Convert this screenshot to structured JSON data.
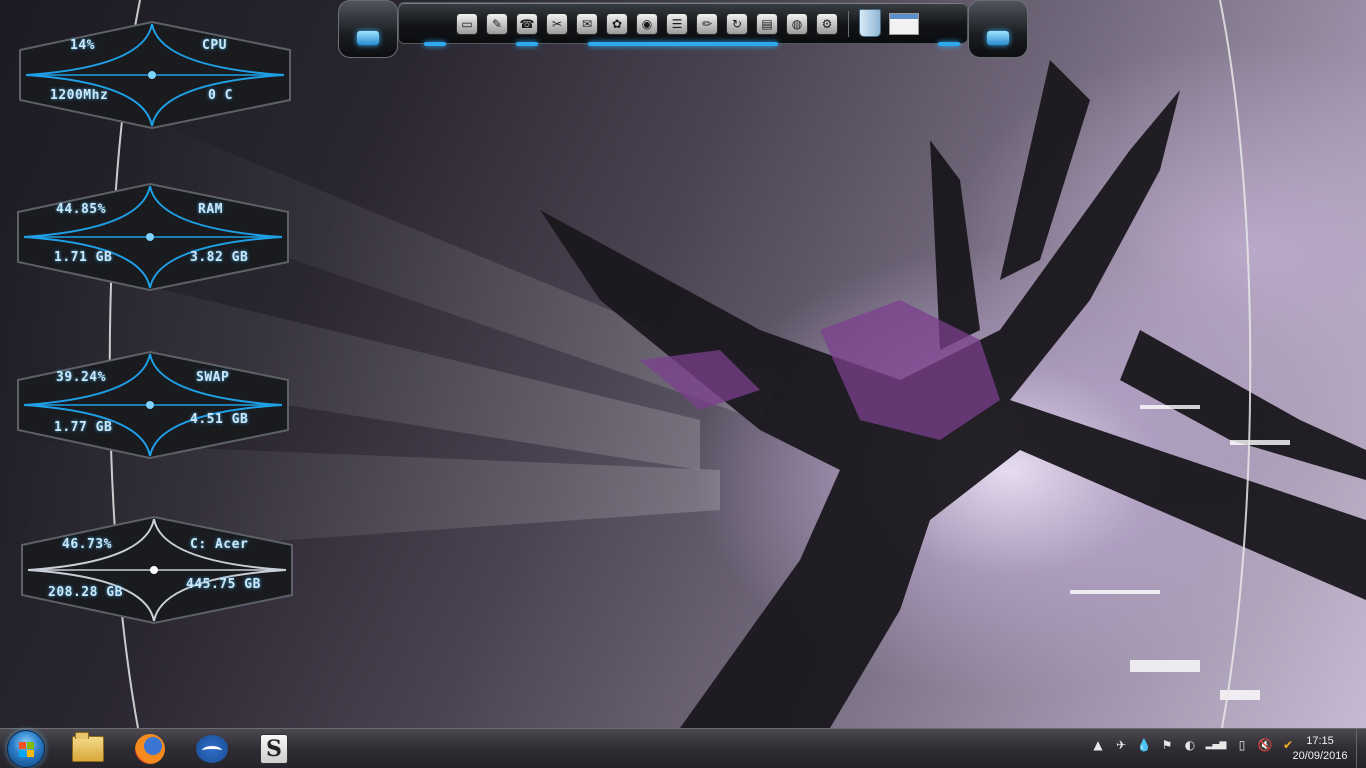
{
  "gadgets": {
    "cpu": {
      "top_left": "14%",
      "top_right": "CPU",
      "bottom_left": "1200Mhz",
      "bottom_right": "0 C"
    },
    "ram": {
      "top_left": "44.85%",
      "top_right": "RAM",
      "bottom_left": "1.71 GB",
      "bottom_right": "3.82 GB"
    },
    "swap": {
      "top_left": "39.24%",
      "top_right": "SWAP",
      "bottom_left": "1.77 GB",
      "bottom_right": "4.51 GB"
    },
    "disk": {
      "top_left": "46.73%",
      "top_right": "C: Acer",
      "bottom_left": "208.28 GB",
      "bottom_right": "445.75 GB"
    }
  },
  "gadget_colors": {
    "blue_accent": "#1f9fe6",
    "silver_accent": "#c9cfd6"
  },
  "dock": {
    "icons": [
      "computer-icon",
      "documents-icon",
      "network-icon",
      "tools-icon",
      "monitor-icon",
      "users-icon",
      "settings-disc-icon",
      "notes-icon",
      "pen-icon",
      "refresh-icon",
      "folder-icon",
      "webcam-icon",
      "gear-icon"
    ],
    "glyphs": [
      "▭",
      "✎",
      "☎",
      "✂",
      "✉",
      "✿",
      "◉",
      "☰",
      "✏",
      "↻",
      "▤",
      "◍",
      "⚙"
    ],
    "extras": [
      "recycle-bin-icon",
      "window-preview-icon"
    ]
  },
  "taskbar": {
    "pinned": [
      "windows-explorer",
      "firefox",
      "openoffice",
      "scribus"
    ],
    "scribus_glyph": "S",
    "tray_glyphs": [
      "▲",
      "✈",
      "💧",
      "⚑",
      "◐",
      "▂▄▆",
      "▯",
      "🔇",
      "✔"
    ],
    "clock": {
      "time": "17:15",
      "date": "20/09/2016"
    }
  }
}
